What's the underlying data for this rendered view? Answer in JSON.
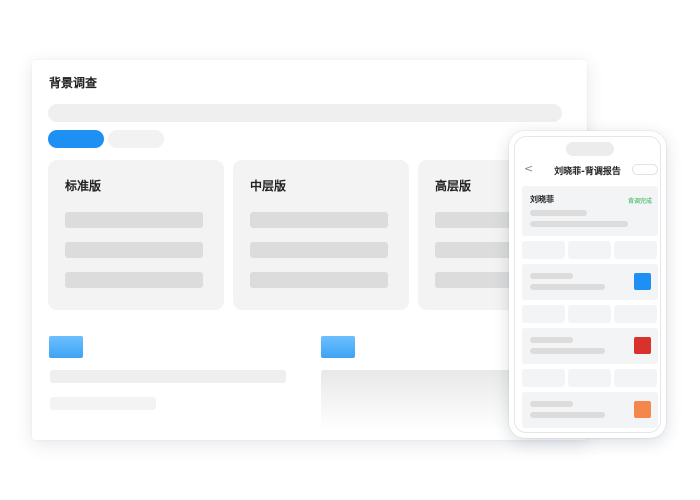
{
  "window": {
    "title": "背景调查",
    "cards": [
      {
        "title": "标准版"
      },
      {
        "title": "中层版"
      },
      {
        "title": "高层版"
      }
    ]
  },
  "phone": {
    "back_icon": "chevron-left-icon",
    "back_glyph": "<",
    "title": "刘晓菲-背调报告",
    "candidate": {
      "name": "刘晓菲",
      "status": "背调完成"
    },
    "items": [
      {
        "badge_color": "#1e90f4"
      },
      {
        "badge_color": "#d9322c"
      },
      {
        "badge_color": "#f5874a"
      }
    ]
  },
  "colors": {
    "accent": "#1e90f4",
    "status_green": "#22b14c"
  }
}
